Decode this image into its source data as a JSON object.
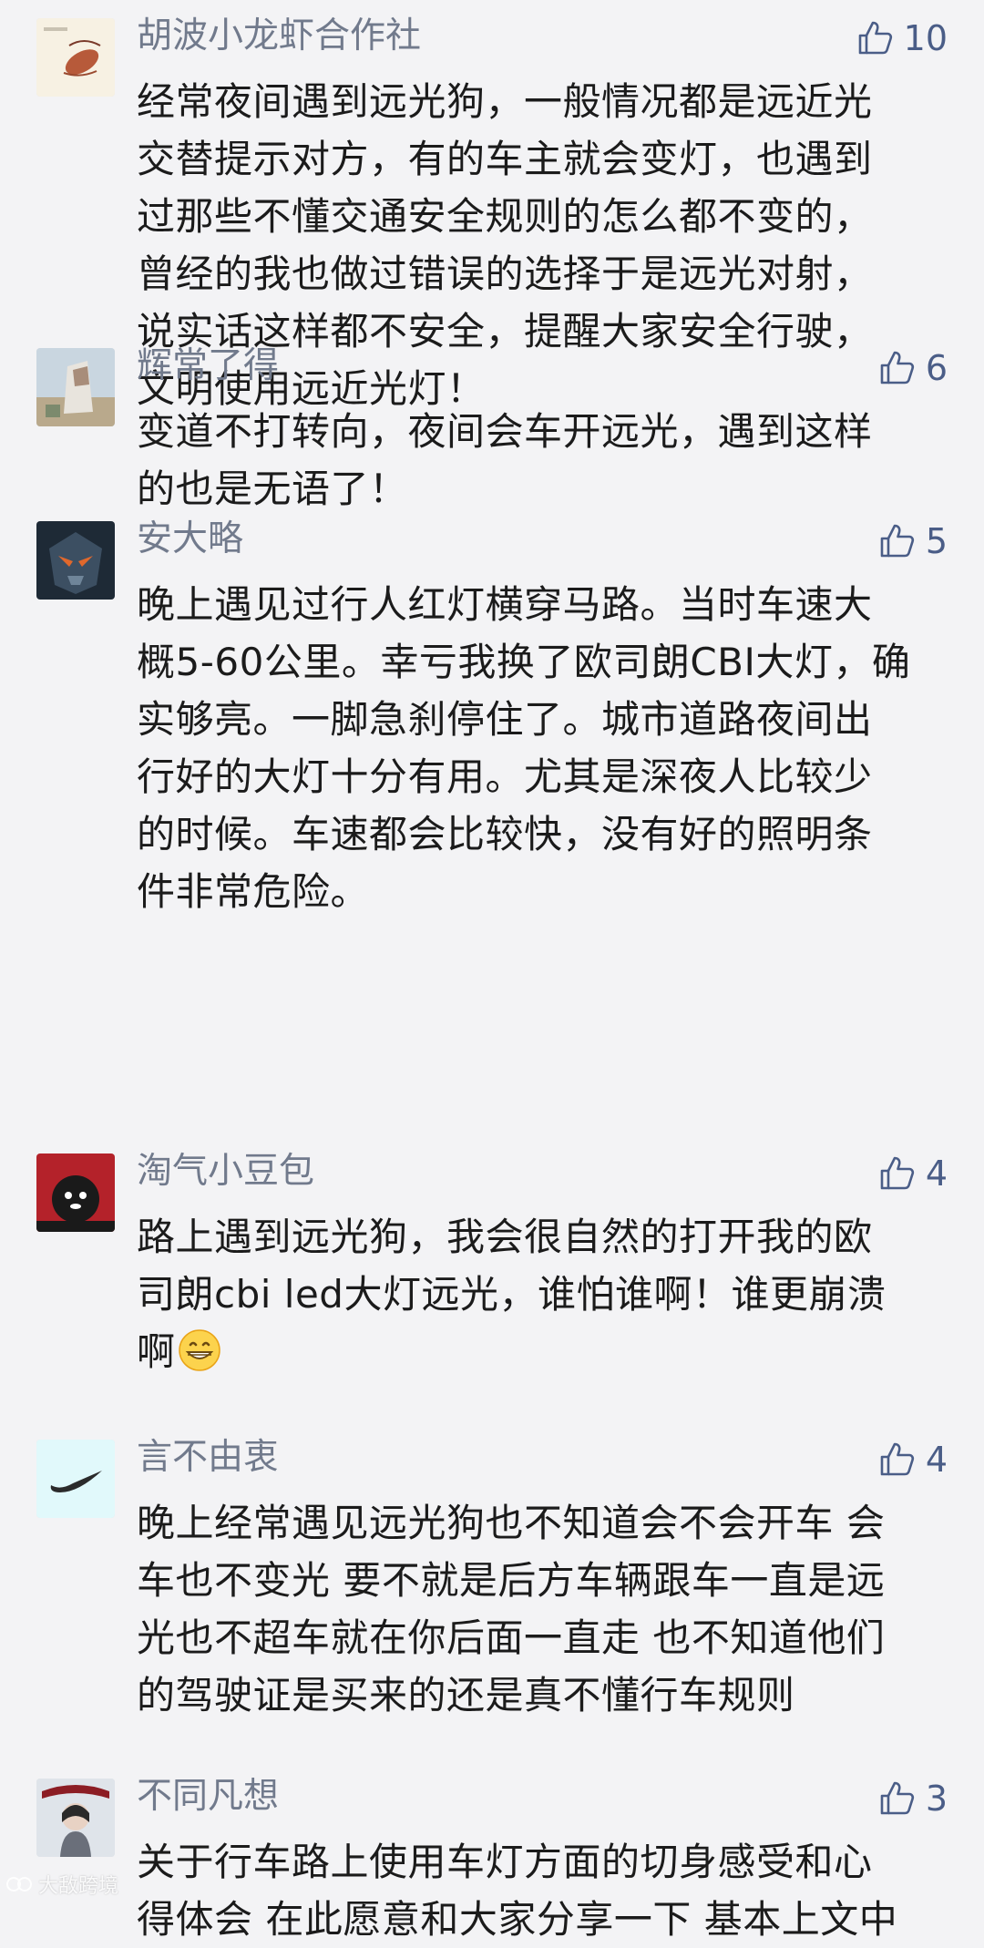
{
  "comments": [
    {
      "nickname": "胡波小龙虾合作社",
      "likes": "10",
      "content": "经常夜间遇到远光狗，一般情况都是远近光\n交替提示对方，有的车主就会变灯，也遇到\n过那些不懂交通安全规则的怎么都不变的，\n曾经的我也做过错误的选择于是远光对射，\n说实话这样都不安全，提醒大家安全行驶，\n文明使用远近光灯！"
    },
    {
      "nickname": "辉常了得",
      "likes": "6",
      "content": "变道不打转向，夜间会车开远光，遇到这样\n的也是无语了！"
    },
    {
      "nickname": "安大略",
      "likes": "5",
      "content": "晚上遇见过行人红灯横穿马路。当时车速大\n概5-60公里。幸亏我换了欧司朗CBI大灯，确\n实够亮。一脚急刹停住了。城市道路夜间出\n行好的大灯十分有用。尤其是深夜人比较少\n的时候。车速都会比较快，没有好的照明条\n件非常危险。"
    },
    {
      "nickname": "淘气小豆包",
      "likes": "4",
      "content": "路上遇到远光狗，我会很自然的打开我的欧\n司朗cbi  led大灯远光，谁怕谁啊！谁更崩溃\n啊",
      "emoji": "grinning-face"
    },
    {
      "nickname": "言不由衷",
      "likes": "4",
      "content": "晚上经常遇见远光狗也不知道会不会开车 会\n车也不变光 要不就是后方车辆跟车一直是远\n光也不超车就在你后面一直走 也不知道他们\n的驾驶证是买来的还是真不懂行车规则"
    },
    {
      "nickname": "不同凡想",
      "likes": "3",
      "content": "关于行车路上使用车灯方面的切身感受和心\n得体会 在此愿意和大家分享一下 基本上文中"
    }
  ],
  "watermark": {
    "text": "大敌跨境"
  },
  "colors": {
    "background": "#f3f3f5",
    "nickname": "#717a8c",
    "like": "#4a5d87",
    "text": "#1b1b1b"
  },
  "icons": {
    "like": "thumbs-up-icon",
    "emoji": "grinning-face"
  }
}
